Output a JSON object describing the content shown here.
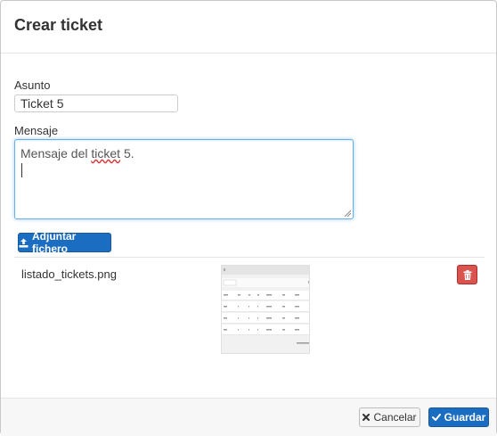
{
  "modal": {
    "title": "Crear ticket"
  },
  "form": {
    "subject_label": "Asunto",
    "subject_value": "Ticket 5",
    "message_label": "Mensaje",
    "message_prefix": "Mensaje del ",
    "message_misspelled_word": "ticket",
    "message_suffix": " 5."
  },
  "attachments": {
    "add_label": "Adjuntar fichero",
    "add_icon": "upload-icon",
    "files": [
      {
        "name": "listado_tickets.png",
        "delete_icon": "trash-icon"
      }
    ]
  },
  "footer": {
    "cancel_label": "Cancelar",
    "cancel_icon": "close-icon",
    "save_label": "Guardar",
    "save_icon": "check-icon"
  },
  "colors": {
    "primary": "#1b6dc1",
    "danger": "#d9534f",
    "focus_border": "#66afe9"
  }
}
